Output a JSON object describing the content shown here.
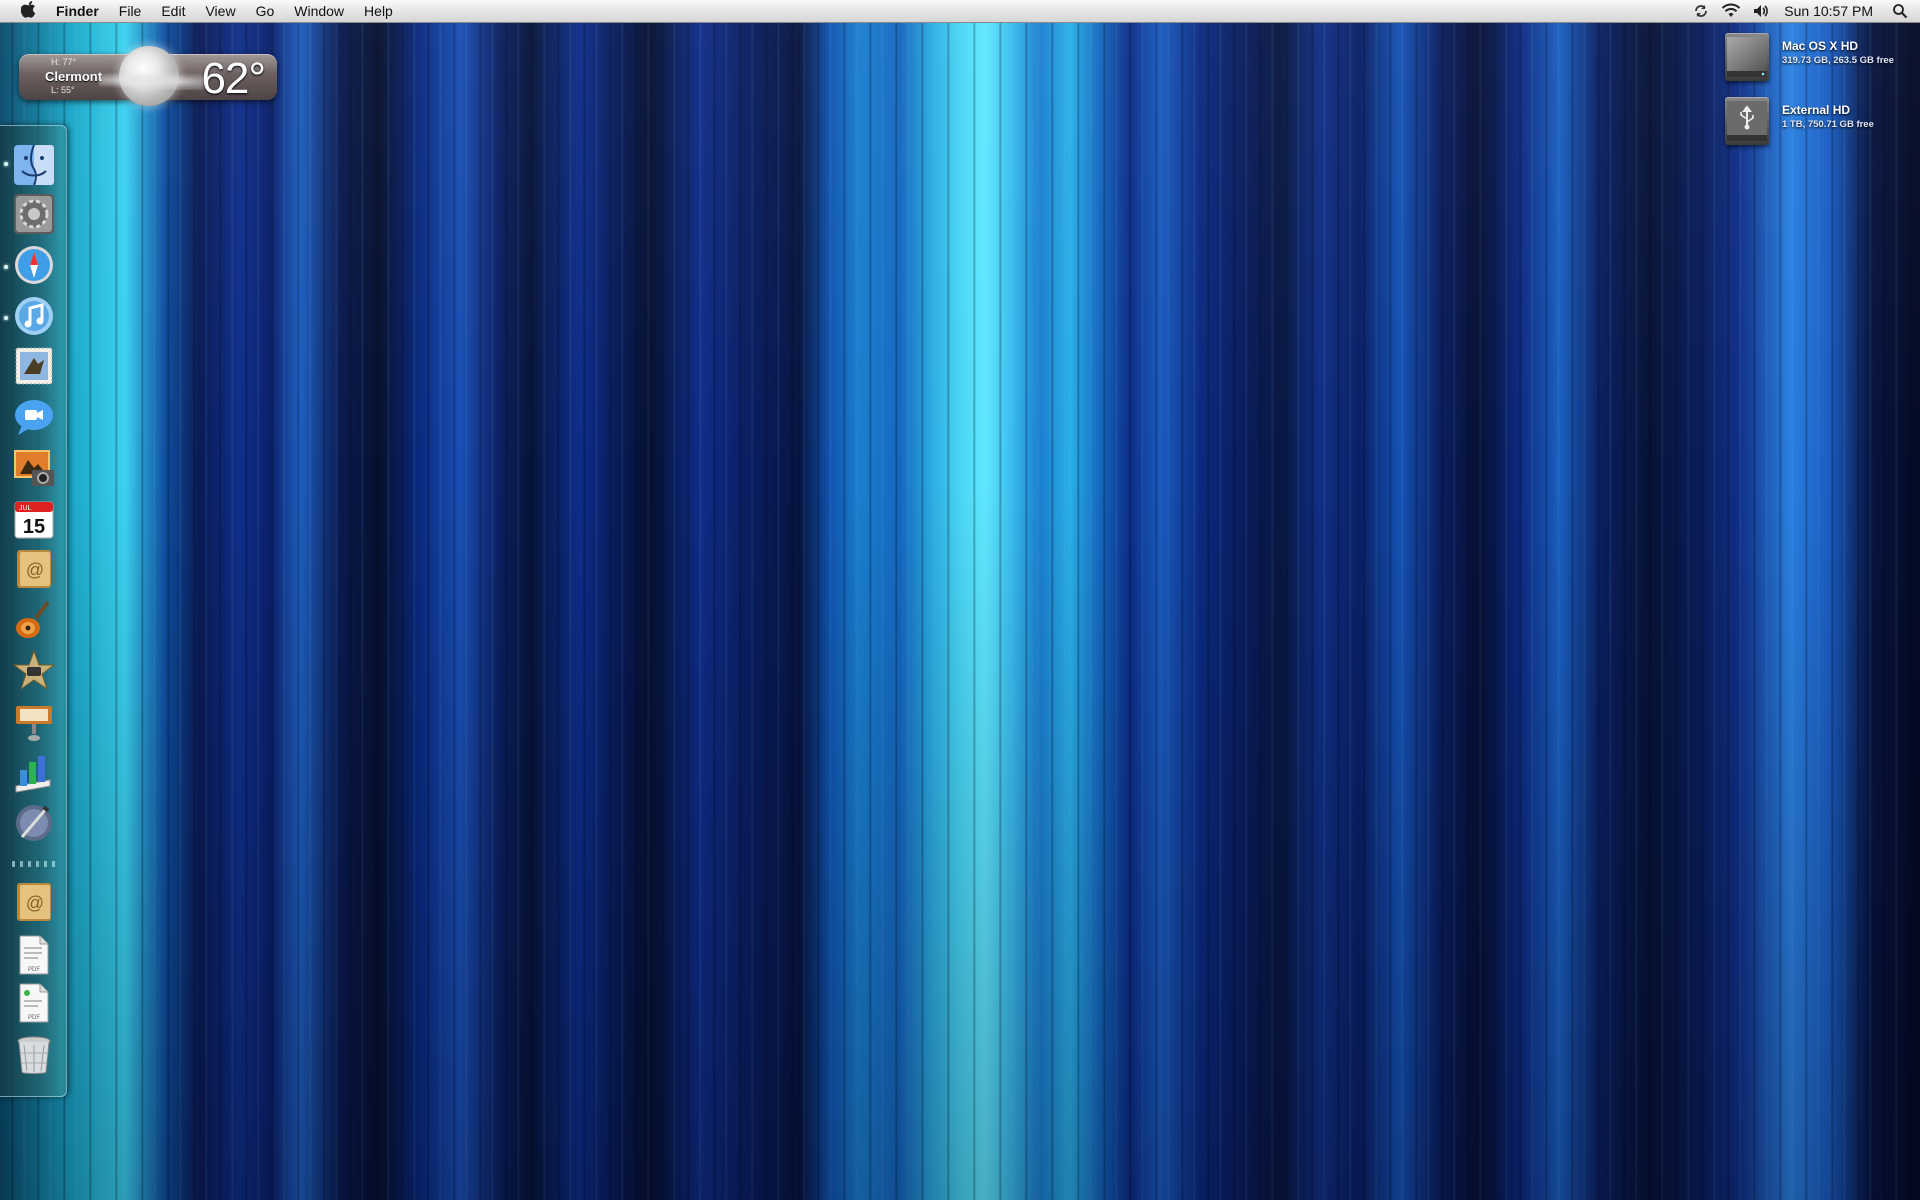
{
  "menubar": {
    "app_name": "Finder",
    "items": [
      "File",
      "Edit",
      "View",
      "Go",
      "Window",
      "Help"
    ],
    "clock": "Sun 10:57 PM",
    "status_icons": [
      "time-machine-sync-icon",
      "wifi-icon",
      "volume-icon"
    ],
    "spotlight_icon": "spotlight-search-icon"
  },
  "weather": {
    "high": "H: 77°",
    "city": "Clermont",
    "low": "L: 55°",
    "temperature": "62°",
    "condition_icon": "moon-partly-cloudy-icon"
  },
  "dock": {
    "items": [
      {
        "name": "finder",
        "running": true
      },
      {
        "name": "system-preferences",
        "running": false
      },
      {
        "name": "safari",
        "running": true
      },
      {
        "name": "itunes",
        "running": true
      },
      {
        "name": "mail",
        "running": false
      },
      {
        "name": "ichat",
        "running": false
      },
      {
        "name": "iphoto",
        "running": false
      },
      {
        "name": "ical",
        "running": false
      },
      {
        "name": "address-book",
        "running": false
      },
      {
        "name": "garageband",
        "running": false
      },
      {
        "name": "imovie",
        "running": false
      },
      {
        "name": "keynote",
        "running": false
      },
      {
        "name": "numbers",
        "running": false
      },
      {
        "name": "script-editor",
        "running": false
      },
      {
        "name": "address-book-stack",
        "running": false
      },
      {
        "name": "pdf-document-1",
        "running": false
      },
      {
        "name": "pdf-document-2",
        "running": false
      },
      {
        "name": "trash",
        "running": false
      }
    ],
    "calendar_day": "15",
    "calendar_month": "JUL"
  },
  "drives": [
    {
      "name": "Mac OS X HD",
      "info": "319.73 GB, 263.5 GB free",
      "icon": "internal-hard-drive-icon"
    },
    {
      "name": "External HD",
      "info": "1 TB, 750.71 GB free",
      "icon": "external-usb-drive-icon"
    }
  ],
  "colors": {
    "menubar_top": "#fafafa",
    "menubar_bottom": "#d6d6d6",
    "desktop_accent": "#48d6f5",
    "desktop_dark": "#0a1a55"
  }
}
